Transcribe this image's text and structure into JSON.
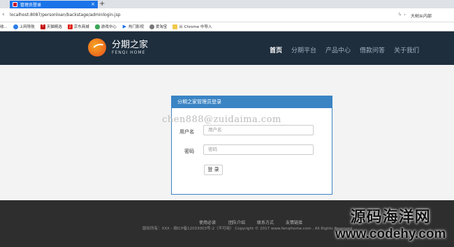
{
  "browser": {
    "tab_title": "管理员登录",
    "new_tab": "+",
    "close": "×",
    "url": "localhost:8087/personloan/backstage/adminlogin.jsp",
    "right_text": "大树从内部",
    "bookmarks": [
      {
        "label": "收...",
        "color": "#999"
      },
      {
        "label": "上网导航",
        "color": "#2b7de9"
      },
      {
        "label": "天猫精选",
        "color": "#c40000"
      },
      {
        "label": "京东商城",
        "color": "#e1251b"
      },
      {
        "label": "游戏中心",
        "color": "#3aa757"
      },
      {
        "label": "热门影视",
        "color": "#1a73e8"
      },
      {
        "label": "爱淘宝",
        "color": "#777"
      },
      {
        "label": "从 Chrome 中导入",
        "color": "#f2c94c"
      }
    ]
  },
  "header": {
    "logo_cn": "分期之家",
    "logo_en": "FENQI HOME",
    "nav": [
      "首页",
      "分期平台",
      "产品中心",
      "借款问答",
      "关于我们"
    ]
  },
  "login": {
    "title": "分期之家管理员登录",
    "watermark": "chen888@zuidaima.com",
    "username_label": "用户名",
    "username_placeholder": "用户名",
    "password_label": "密码",
    "password_placeholder": "密码",
    "button": "登 录"
  },
  "footer": {
    "links": [
      "使用必读",
      "团队介绍",
      "联系方式",
      "友情链接"
    ],
    "copyright": "版权所有：XXX - 赣ICP备12033003号-2（不可用）   Copyright © 2017 www.fenqihome.com , All Rights Reserved"
  },
  "overlay": {
    "brand": "源码海洋网",
    "site": "www.codehy.com"
  },
  "colors": {
    "header_bg": "#1e2e3d",
    "panel_accent": "#3a84c4",
    "footer_bg": "#2e2e2e"
  }
}
